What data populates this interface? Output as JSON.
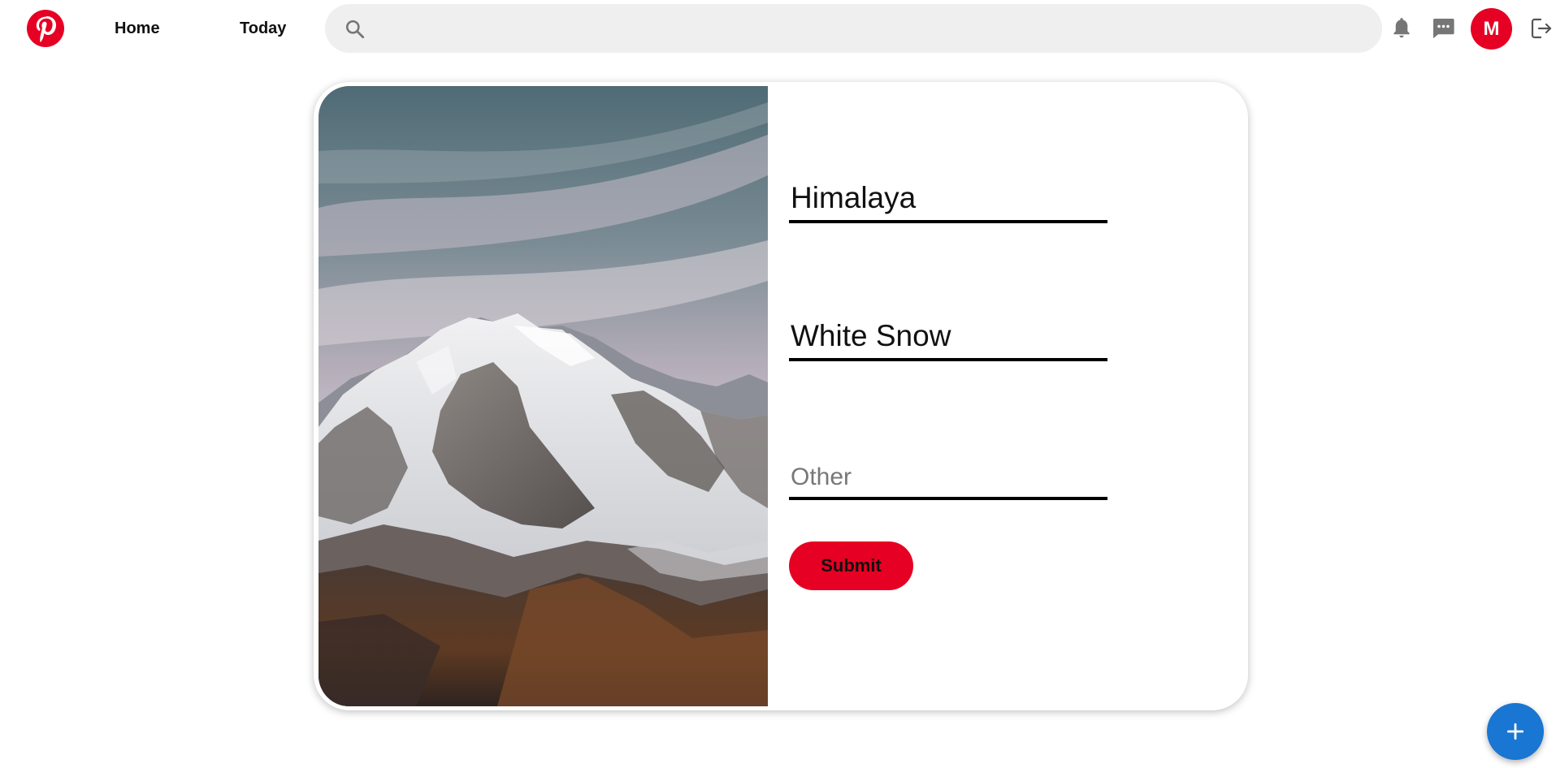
{
  "header": {
    "nav": {
      "home_label": "Home",
      "today_label": "Today"
    },
    "search": {
      "placeholder": "",
      "value": ""
    },
    "avatar_initial": "M",
    "icons": [
      "pinterest-logo-icon",
      "search-icon",
      "bell-icon",
      "chat-icon",
      "logout-icon"
    ]
  },
  "form": {
    "title_value": "Himalaya",
    "description_value": "White Snow",
    "other_placeholder": "Other",
    "other_value": "",
    "submit_label": "Submit"
  },
  "fab": {
    "icon": "plus-icon"
  },
  "colors": {
    "brand_red": "#e60023",
    "fab_blue": "#1976d2",
    "search_bg": "#efefef",
    "underline": "#000000"
  }
}
